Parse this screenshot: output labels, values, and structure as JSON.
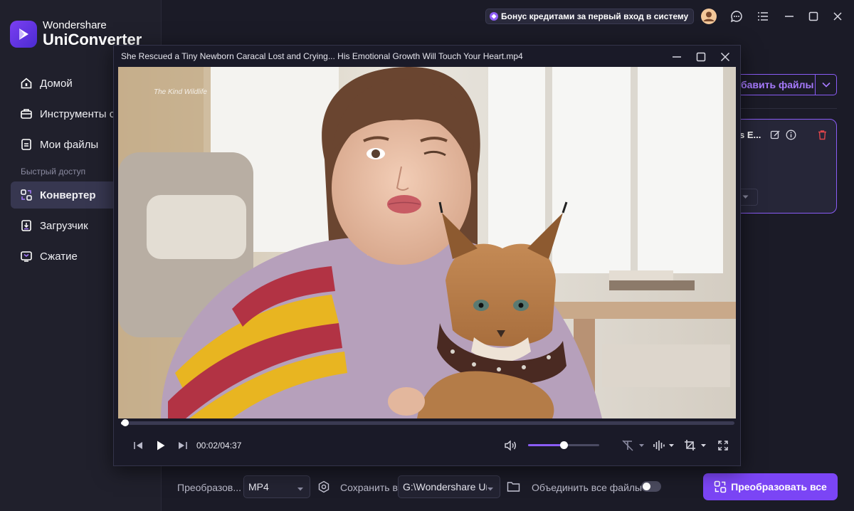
{
  "app": {
    "brand_line1": "Wondershare",
    "brand_line2": "UniConverter"
  },
  "sidebar": {
    "items": [
      {
        "label": "Домой",
        "icon": "home-icon"
      },
      {
        "label": "Инструменты с",
        "icon": "toolbox-icon"
      },
      {
        "label": "Мои файлы",
        "icon": "files-icon"
      }
    ],
    "section_label": "Быстрый доступ",
    "quick_items": [
      {
        "label": "Конвертер",
        "icon": "converter-icon",
        "active": true
      },
      {
        "label": "Загрузчик",
        "icon": "download-icon"
      },
      {
        "label": "Сжатие",
        "icon": "compress-icon"
      }
    ]
  },
  "topbar": {
    "promo": "Бонус кредитами за первый вход в систему"
  },
  "main": {
    "add_files_label": "бавить файлы",
    "file_name_partial": "s E..."
  },
  "bottom": {
    "output_format_label": "Преобразов...",
    "output_format_value": "MP4",
    "save_to_label": "Сохранить в",
    "save_path": "G:\\Wondershare Ur",
    "merge_label": "Объединить все файлы",
    "merge_enabled": false,
    "convert_all_label": "Преобразовать все"
  },
  "player": {
    "title": "She Rescued a Tiny Newborn Caracal Lost and Crying... His Emotional Growth Will Touch Your Heart.mp4",
    "watermark": "The Kind Wildlife",
    "current_time": "00:02/04:37",
    "progress": 0.007,
    "volume": 0.5
  },
  "colors": {
    "accent": "#7b45f5",
    "delete": "#e0454b"
  }
}
